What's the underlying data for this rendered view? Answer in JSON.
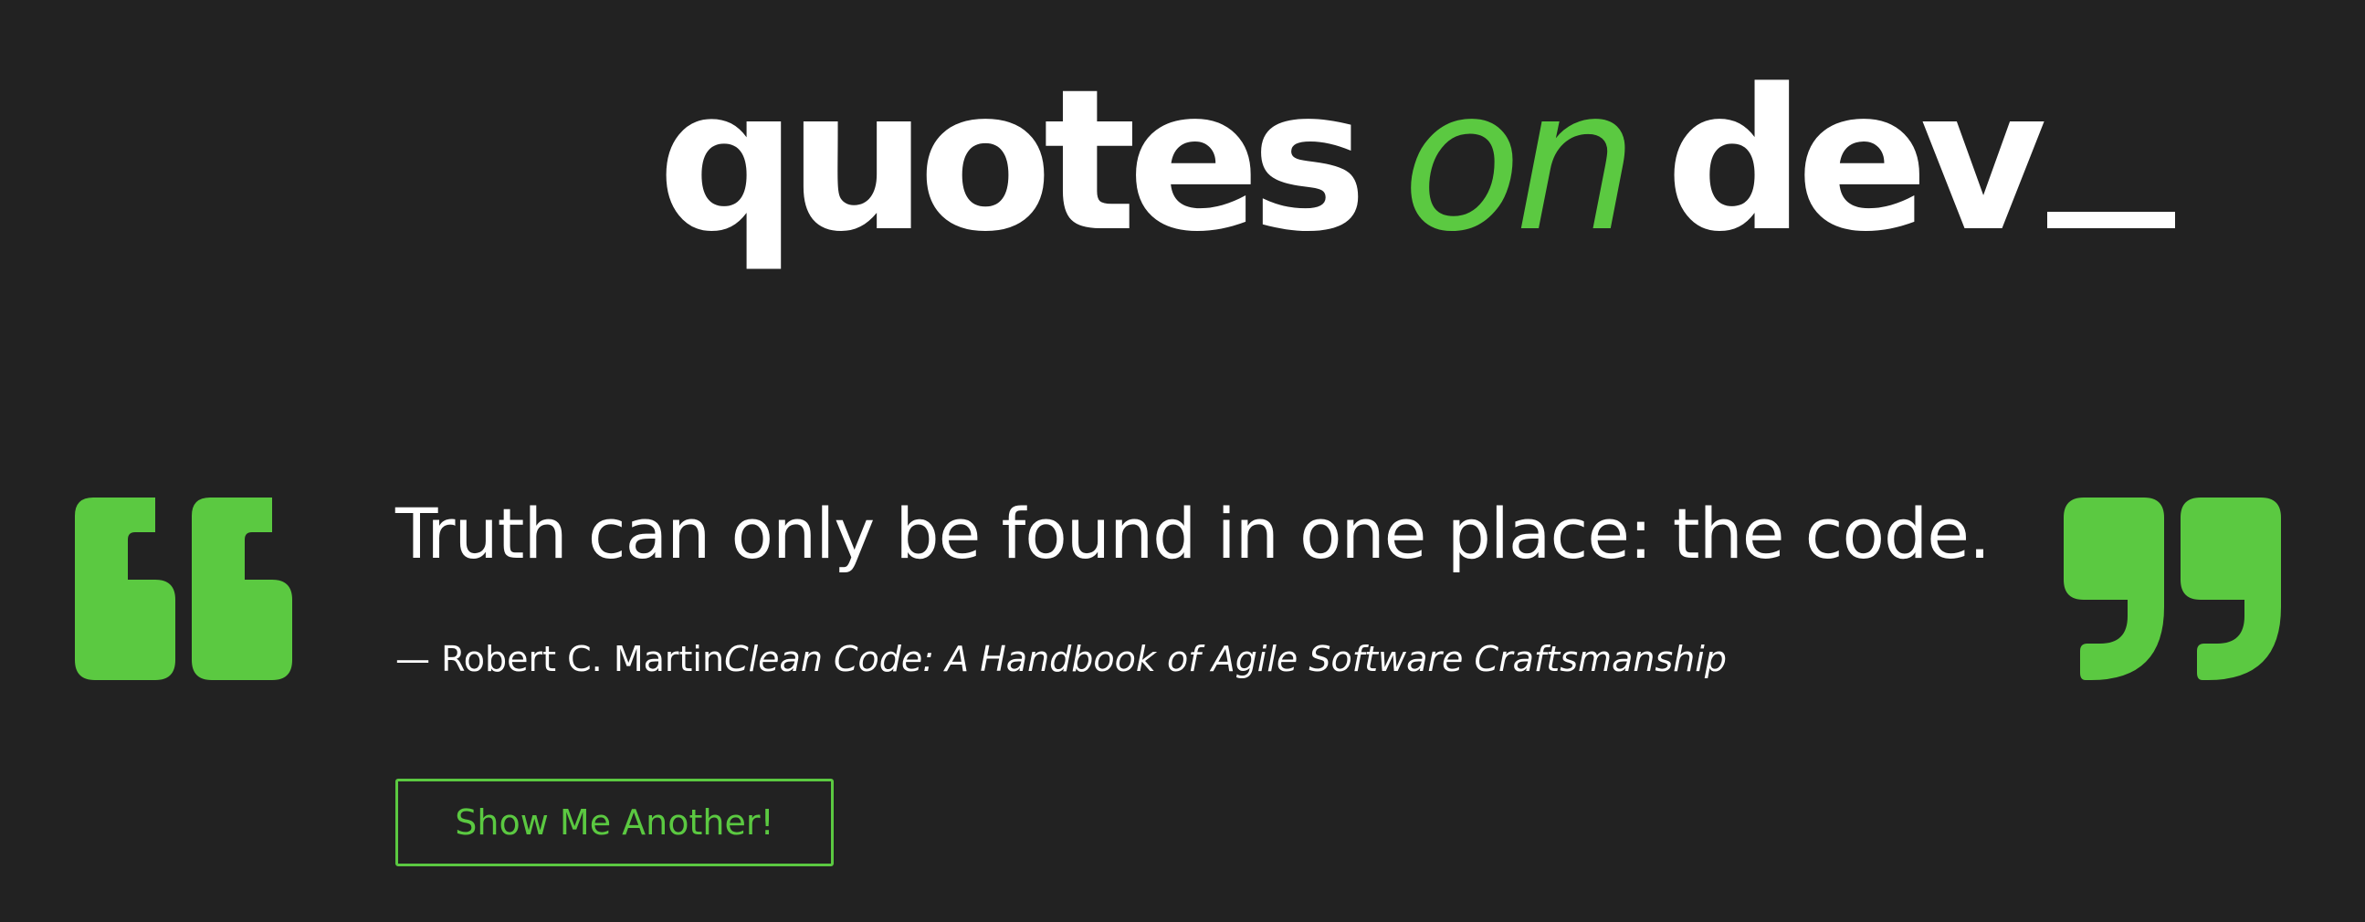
{
  "brand": {
    "word1": "quotes",
    "word2": "on",
    "word3": "dev"
  },
  "quote": {
    "text": "Truth can only be found in one place: the code.",
    "author_prefix": "— Robert C. Martin",
    "source": "Clean Code: A Handbook of Agile Software Craftsmanship"
  },
  "actions": {
    "another_label": "Show Me Another!"
  },
  "icons": {
    "open_quote": "open-quote-icon",
    "close_quote": "close-quote-icon"
  },
  "colors": {
    "background": "#222222",
    "accent": "#5bc941",
    "text": "#ffffff"
  }
}
